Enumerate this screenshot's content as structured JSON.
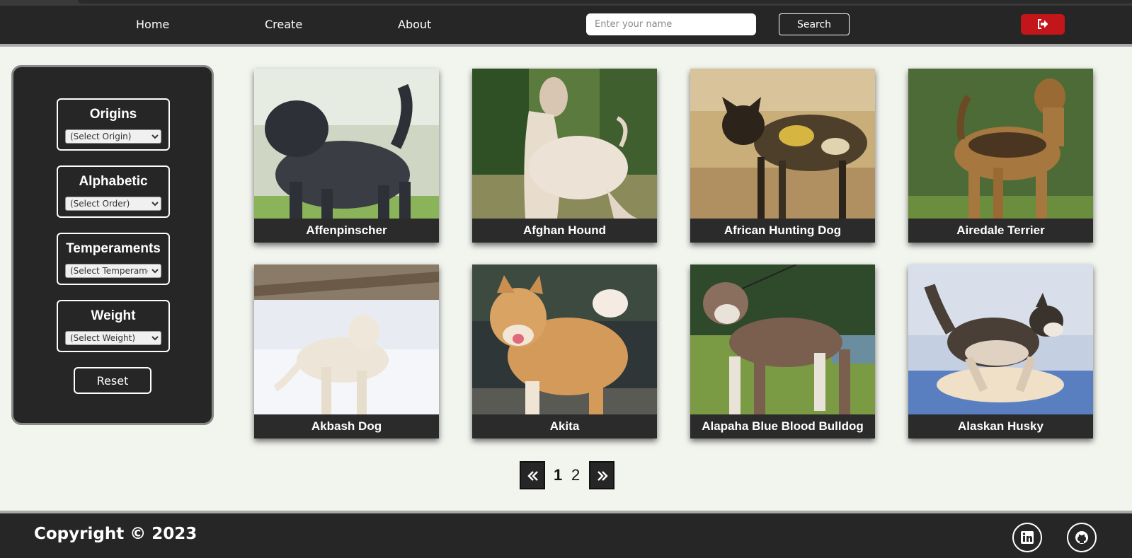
{
  "nav": {
    "links": [
      "Home",
      "Create",
      "About"
    ],
    "search_placeholder": "Enter your name",
    "search_label": "Search",
    "logout_icon": "sign-out-icon",
    "logout_color": "#c3161a"
  },
  "filters": [
    {
      "title": "Origins",
      "selected": "(Select Origin)"
    },
    {
      "title": "Alphabetic",
      "selected": "(Select Order)"
    },
    {
      "title": "Temperaments",
      "selected": "(Select Temperaments)"
    },
    {
      "title": "Weight",
      "selected": "(Select Weight)"
    }
  ],
  "reset_label": "Reset",
  "dogs": [
    {
      "name": "Affenpinscher",
      "photo": "black shaggy dog on grass"
    },
    {
      "name": "Afghan Hound",
      "photo": "long-haired cream hound in park"
    },
    {
      "name": "African Hunting Dog",
      "photo": "painted wild dog in dry grass"
    },
    {
      "name": "Airedale Terrier",
      "photo": "tan terrier in front of hedge"
    },
    {
      "name": "Akbash Dog",
      "photo": "white dog standing in snow"
    },
    {
      "name": "Akita",
      "photo": "red and white akita smiling"
    },
    {
      "name": "Alapaha Blue Blood Bulldog",
      "photo": "brown and white bulldog on grass"
    },
    {
      "name": "Alaskan Husky",
      "photo": "husky running in snow"
    }
  ],
  "pagination": {
    "pages": [
      "1",
      "2"
    ],
    "current": "1",
    "prev_icon": "double-chevron-left-icon",
    "next_icon": "double-chevron-right-icon"
  },
  "footer": {
    "copyright": "Copyright © 2023",
    "icons": [
      "linkedin-icon",
      "github-icon"
    ]
  },
  "colors": {
    "dark": "#262626",
    "background": "#f2f4ee",
    "accent_red": "#c3161a"
  }
}
